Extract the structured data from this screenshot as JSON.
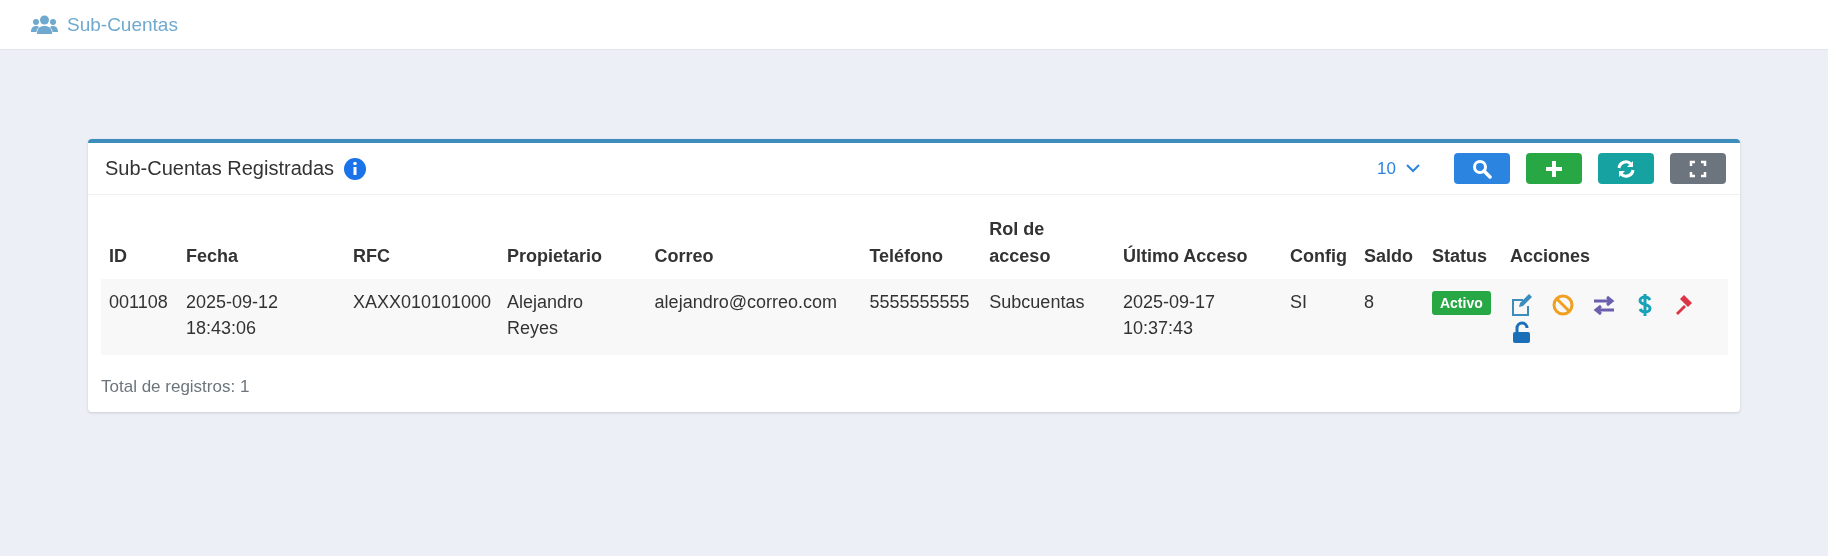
{
  "header": {
    "title": "Sub-Cuentas"
  },
  "card": {
    "title": "Sub-Cuentas Registradas",
    "page_size": "10",
    "toolbar": [
      {
        "kind": "search"
      },
      {
        "kind": "add"
      },
      {
        "kind": "refresh"
      },
      {
        "kind": "fullscreen"
      }
    ]
  },
  "table": {
    "columns": [
      "ID",
      "Fecha",
      "RFC",
      "Propietario",
      "Correo",
      "Teléfono",
      "Rol de acceso",
      "Último Acceso",
      "Config",
      "Saldo",
      "Status",
      "Acciones"
    ],
    "rows": [
      {
        "cells": [
          "001108",
          "2025-09-12 18:43:06",
          "XAXX010101000",
          "Alejandro Reyes",
          "alejandro@correo.com",
          "5555555555",
          "Subcuentas",
          "2025-09-17 10:37:43",
          "SI",
          "8"
        ],
        "status": "Activo",
        "actions": [
          {
            "kind": "edit"
          },
          {
            "kind": "block"
          },
          {
            "kind": "transfer"
          },
          {
            "kind": "balance"
          },
          {
            "kind": "gavel"
          },
          {
            "kind": "unlock"
          }
        ]
      }
    ]
  },
  "footer": {
    "total": "Total de registros: 1"
  }
}
